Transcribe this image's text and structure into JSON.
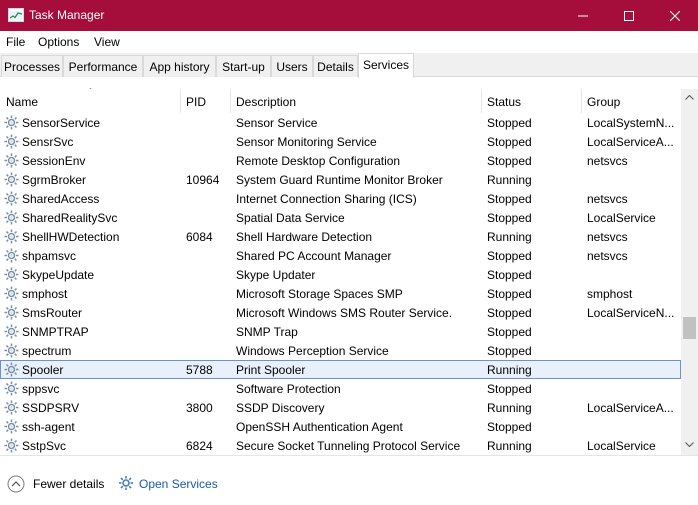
{
  "window": {
    "title": "Task Manager",
    "accent_color": "#a50d3a"
  },
  "menu": [
    "File",
    "Options",
    "View"
  ],
  "tabs": [
    {
      "label": "Processes",
      "active": false
    },
    {
      "label": "Performance",
      "active": false
    },
    {
      "label": "App history",
      "active": false
    },
    {
      "label": "Start-up",
      "active": false
    },
    {
      "label": "Users",
      "active": false
    },
    {
      "label": "Details",
      "active": false
    },
    {
      "label": "Services",
      "active": true
    }
  ],
  "columns": {
    "name": "Name",
    "pid": "PID",
    "description": "Description",
    "status": "Status",
    "group": "Group",
    "sorted_by": "Name"
  },
  "services": [
    {
      "name": "SensorService",
      "pid": "",
      "description": "Sensor Service",
      "status": "Stopped",
      "group": "LocalSystemN..."
    },
    {
      "name": "SensrSvc",
      "pid": "",
      "description": "Sensor Monitoring Service",
      "status": "Stopped",
      "group": "LocalServiceA..."
    },
    {
      "name": "SessionEnv",
      "pid": "",
      "description": "Remote Desktop Configuration",
      "status": "Stopped",
      "group": "netsvcs"
    },
    {
      "name": "SgrmBroker",
      "pid": "10964",
      "description": "System Guard Runtime Monitor Broker",
      "status": "Running",
      "group": ""
    },
    {
      "name": "SharedAccess",
      "pid": "",
      "description": "Internet Connection Sharing (ICS)",
      "status": "Stopped",
      "group": "netsvcs"
    },
    {
      "name": "SharedRealitySvc",
      "pid": "",
      "description": "Spatial Data Service",
      "status": "Stopped",
      "group": "LocalService"
    },
    {
      "name": "ShellHWDetection",
      "pid": "6084",
      "description": "Shell Hardware Detection",
      "status": "Running",
      "group": "netsvcs"
    },
    {
      "name": "shpamsvc",
      "pid": "",
      "description": "Shared PC Account Manager",
      "status": "Stopped",
      "group": "netsvcs"
    },
    {
      "name": "SkypeUpdate",
      "pid": "",
      "description": "Skype Updater",
      "status": "Stopped",
      "group": ""
    },
    {
      "name": "smphost",
      "pid": "",
      "description": "Microsoft Storage Spaces SMP",
      "status": "Stopped",
      "group": "smphost"
    },
    {
      "name": "SmsRouter",
      "pid": "",
      "description": "Microsoft Windows SMS Router Service.",
      "status": "Stopped",
      "group": "LocalServiceN..."
    },
    {
      "name": "SNMPTRAP",
      "pid": "",
      "description": "SNMP Trap",
      "status": "Stopped",
      "group": ""
    },
    {
      "name": "spectrum",
      "pid": "",
      "description": "Windows Perception Service",
      "status": "Stopped",
      "group": ""
    },
    {
      "name": "Spooler",
      "pid": "5788",
      "description": "Print Spooler",
      "status": "Running",
      "group": "",
      "selected": true
    },
    {
      "name": "sppsvc",
      "pid": "",
      "description": "Software Protection",
      "status": "Stopped",
      "group": ""
    },
    {
      "name": "SSDPSRV",
      "pid": "3800",
      "description": "SSDP Discovery",
      "status": "Running",
      "group": "LocalServiceA..."
    },
    {
      "name": "ssh-agent",
      "pid": "",
      "description": "OpenSSH Authentication Agent",
      "status": "Stopped",
      "group": ""
    },
    {
      "name": "SstpSvc",
      "pid": "6824",
      "description": "Secure Socket Tunneling Protocol Service",
      "status": "Running",
      "group": "LocalService"
    }
  ],
  "footer": {
    "fewer_details": "Fewer details",
    "open_services": "Open Services"
  }
}
